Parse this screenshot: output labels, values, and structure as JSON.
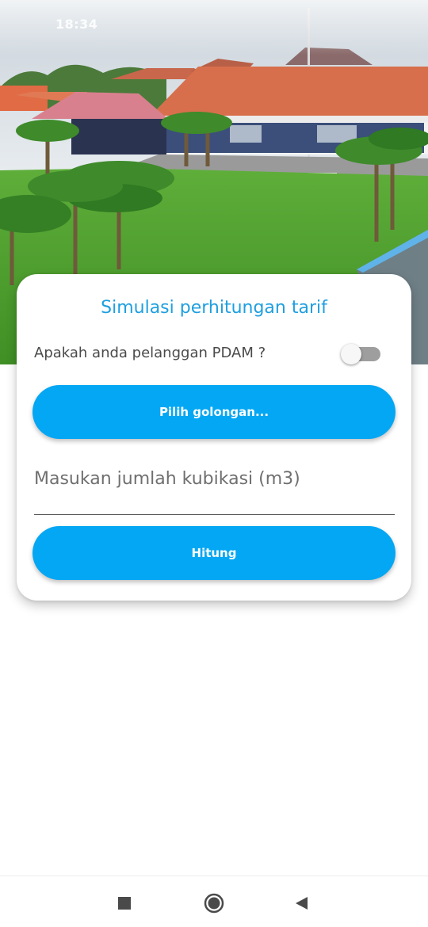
{
  "status_bar": {
    "time": "18:34"
  },
  "card": {
    "title": "Simulasi perhitungan tarif",
    "pdam_question": "Apakah anda pelanggan PDAM ?",
    "pdam_toggle_on": false,
    "golongan_button": "Pilih golongan...",
    "volume_placeholder": "Masukan jumlah kubikasi (m3)",
    "volume_value": "",
    "calculate_button": "Hitung"
  },
  "colors": {
    "accent": "#04a7f3",
    "title": "#1e9fe0",
    "toggle_off": "#9e9e9e"
  },
  "nav": {
    "recents_icon": "square-icon",
    "home_icon": "circle-icon",
    "back_icon": "triangle-back-icon"
  }
}
